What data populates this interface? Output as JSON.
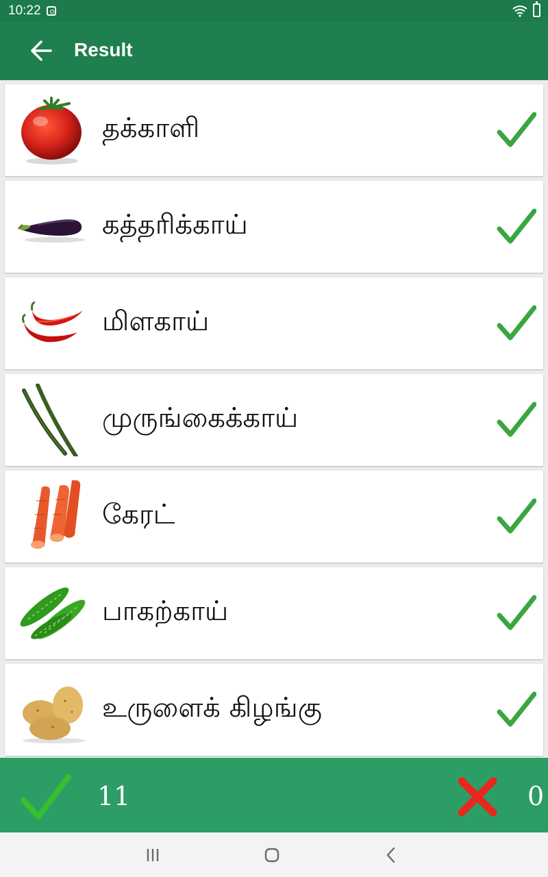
{
  "status_bar": {
    "time": "10:22",
    "icons": [
      "notification-icon",
      "wifi-icon",
      "battery-charging-icon"
    ]
  },
  "app_bar": {
    "back_icon": "arrow-left-icon",
    "title": "Result"
  },
  "results": [
    {
      "name": "தக்காளி",
      "image": "tomato",
      "status": "correct"
    },
    {
      "name": "கத்தரிக்காய்",
      "image": "eggplant",
      "status": "correct"
    },
    {
      "name": "மிளகாய்",
      "image": "red-chili",
      "status": "correct"
    },
    {
      "name": "முருங்கைக்காய்",
      "image": "drumstick",
      "status": "correct"
    },
    {
      "name": "கேரட்",
      "image": "carrot",
      "status": "correct"
    },
    {
      "name": "பாகற்காய்",
      "image": "bitter-gourd",
      "status": "correct"
    },
    {
      "name": "உருளைக் கிழங்கு",
      "image": "potato",
      "status": "correct"
    }
  ],
  "summary": {
    "correct_icon": "check-icon",
    "correct_count": "11",
    "wrong_icon": "cross-icon",
    "wrong_count": "0"
  },
  "nav_bar": {
    "items": [
      "recent-apps-icon",
      "home-icon",
      "back-icon"
    ]
  },
  "colors": {
    "primary": "#1f7f4f",
    "status_bar": "#1c7a4b",
    "footer": "#2d9d66",
    "check": "#3aa640",
    "cross": "#e8281e"
  }
}
